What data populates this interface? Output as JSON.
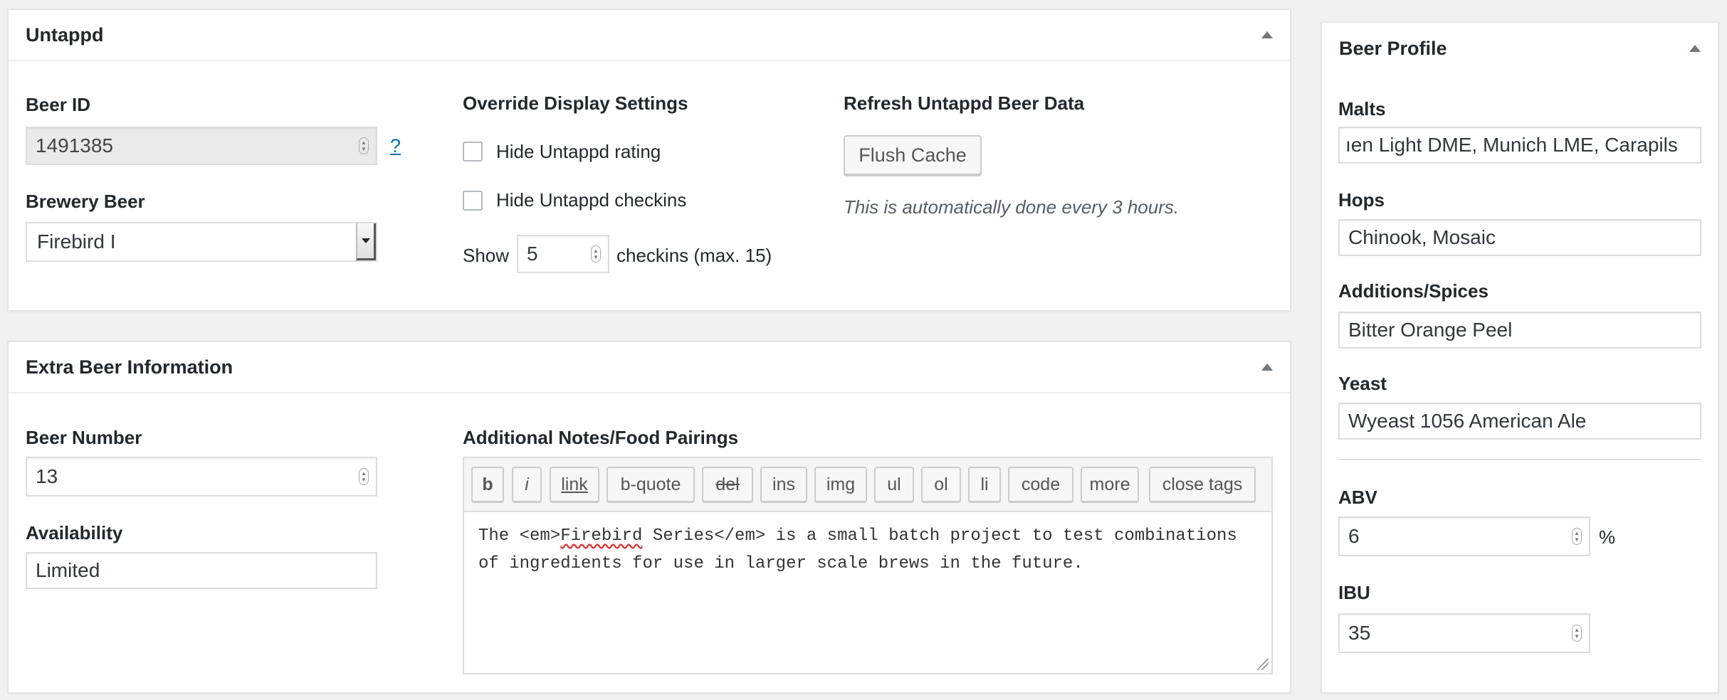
{
  "untappd": {
    "title": "Untappd",
    "beer_id_label": "Beer ID",
    "beer_id_value": "1491385",
    "help_link": "?",
    "brewery_beer_label": "Brewery Beer",
    "brewery_beer_value": "Firebird I",
    "override_title": "Override Display Settings",
    "hide_rating_label": "Hide Untappd rating",
    "hide_checkins_label": "Hide Untappd checkins",
    "show_label": "Show",
    "show_value": "5",
    "checkins_max_label": "checkins (max. 15)",
    "refresh_title": "Refresh Untappd Beer Data",
    "flush_button": "Flush Cache",
    "refresh_note": "This is automatically done every 3 hours."
  },
  "extra": {
    "title": "Extra Beer Information",
    "beer_number_label": "Beer Number",
    "beer_number_value": "13",
    "availability_label": "Availability",
    "availability_value": "Limited",
    "notes_label": "Additional Notes/Food Pairings",
    "quicktags": [
      "b",
      "i",
      "link",
      "b-quote",
      "del",
      "ins",
      "img",
      "ul",
      "ol",
      "li",
      "code",
      "more",
      "close tags"
    ],
    "notes_prefix": "The <em>",
    "notes_misspelled": "Firebird",
    "notes_suffix_line1": " Series</em> is a small batch project to test combinations",
    "notes_line2": "of ingredients for use in larger scale brews in the future."
  },
  "profile": {
    "title": "Beer Profile",
    "malts_label": "Malts",
    "malts_value": "ıen Light DME, Munich LME, Carapils",
    "hops_label": "Hops",
    "hops_value": "Chinook, Mosaic",
    "additions_label": "Additions/Spices",
    "additions_value": "Bitter Orange Peel",
    "yeast_label": "Yeast",
    "yeast_value": "Wyeast 1056 American Ale",
    "abv_label": "ABV",
    "abv_value": "6",
    "abv_unit": "%",
    "ibu_label": "IBU",
    "ibu_value": "35"
  },
  "colors": {
    "background": "#f1f1f1",
    "link": "#0073aa",
    "spellcheck": "#d63638"
  }
}
